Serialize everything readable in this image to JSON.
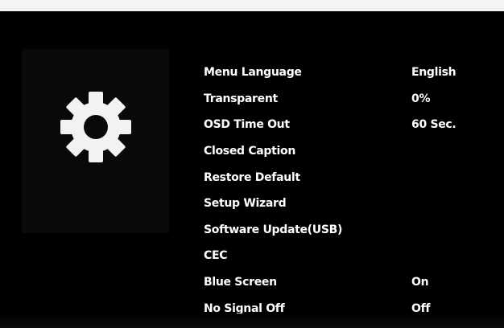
{
  "menu": {
    "items": [
      {
        "label": "Menu Language",
        "value": "English"
      },
      {
        "label": "Transparent",
        "value": "0%"
      },
      {
        "label": "OSD Time Out",
        "value": "60 Sec."
      },
      {
        "label": "Closed Caption",
        "value": ""
      },
      {
        "label": "Restore Default",
        "value": ""
      },
      {
        "label": "Setup Wizard",
        "value": ""
      },
      {
        "label": "Software Update(USB)",
        "value": ""
      },
      {
        "label": "CEC",
        "value": ""
      },
      {
        "label": "Blue Screen",
        "value": "On"
      },
      {
        "label": "No Signal Off",
        "value": "Off"
      }
    ]
  },
  "icon": {
    "name": "gear-icon",
    "color": "#f2f2f2"
  },
  "colors": {
    "background": "#000000",
    "text": "#ffffff",
    "panel": "#090909"
  }
}
